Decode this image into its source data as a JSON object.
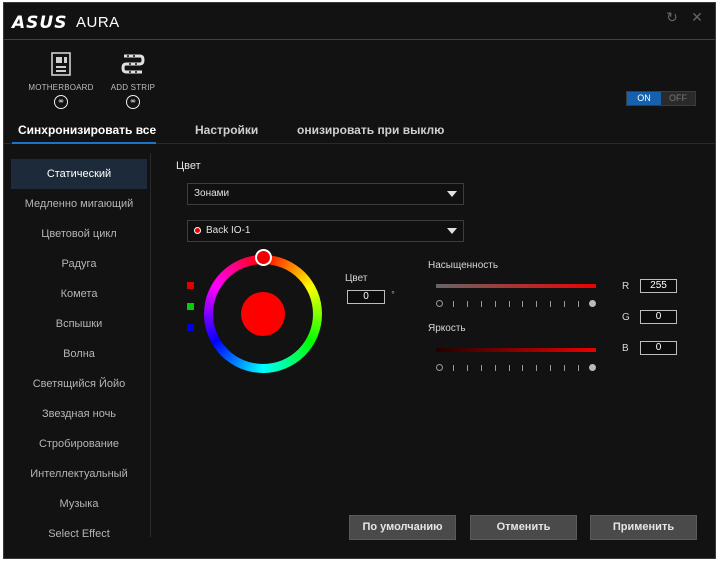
{
  "window": {
    "logo": "ASUS",
    "title": "AURA",
    "refresh_icon": "refresh-icon",
    "close_icon": "close-icon"
  },
  "devices": [
    {
      "label": "MOTHERBOARD",
      "icon": "motherboard-icon",
      "badge": "link-icon"
    },
    {
      "label": "ADD STRIP",
      "icon": "led-strip-icon",
      "badge": "link-icon"
    }
  ],
  "power": {
    "on": "ON",
    "off": "OFF",
    "selected": "ON",
    "accent": "#1561ad"
  },
  "tabs": [
    {
      "label": "Синхронизировать все"
    },
    {
      "label": "Настройки"
    },
    {
      "label": "онизировать при выклю"
    }
  ],
  "effects": [
    "Статический",
    "Медленно мигающий",
    "Цветовой цикл",
    "Радуга",
    "Комета",
    "Вспышки",
    "Волна",
    "Светящийся Йойо",
    "Звездная ночь",
    "Стробирование",
    "Интеллектуальный",
    "Музыка",
    "Select Effect"
  ],
  "color_panel": {
    "title": "Цвет",
    "zone_dropdown": "Зонами",
    "area_dropdown": "Back IO-1",
    "hue_label": "Цвет",
    "hue_value": "0",
    "degree_symbol": "°",
    "saturation_label": "Насыщенность",
    "brightness_label": "Яркость",
    "saturation_level": 1.0,
    "brightness_level": 1.0,
    "r_label": "R",
    "r_value": "255",
    "g_label": "G",
    "g_value": "0",
    "b_label": "B",
    "b_value": "0",
    "current_color": "#ff0000"
  },
  "buttons": {
    "default": "По умолчанию",
    "cancel": "Отменить",
    "apply": "Применить"
  }
}
